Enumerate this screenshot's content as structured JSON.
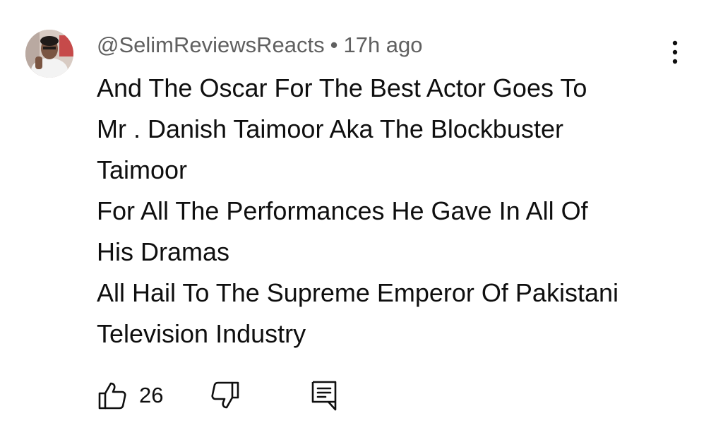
{
  "comment": {
    "author": "@SelimReviewsReacts",
    "separator": "•",
    "time": "17h ago",
    "lines": [
      "And The Oscar For The Best Actor Goes To",
      "Mr . Danish Taimoor Aka The Blockbuster",
      "Taimoor",
      "For All The Performances He Gave In All Of",
      "His Dramas",
      "All Hail To The Supreme Emperor Of Pakistani",
      "Television Industry"
    ],
    "like_count": "26"
  },
  "icons": {
    "avatar": "avatar",
    "menu": "more-vertical-icon",
    "like": "thumbs-up-icon",
    "dislike": "thumbs-down-icon",
    "reply": "comment-reply-icon"
  },
  "colors": {
    "text": "#0f0f0f",
    "meta_text": "#606060",
    "background": "#ffffff"
  }
}
